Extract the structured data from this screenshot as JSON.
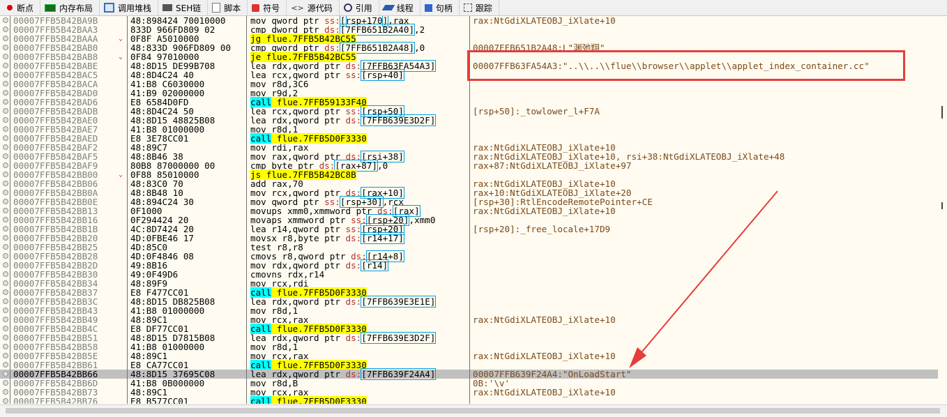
{
  "tabs": [
    {
      "label": "断点",
      "icon": "breakpoint-dot-icon",
      "cls": "ic-dot"
    },
    {
      "label": "内存布局",
      "icon": "memory-map-icon",
      "cls": "ic-mem"
    },
    {
      "label": "调用堆栈",
      "icon": "call-stack-icon",
      "cls": "ic-stack"
    },
    {
      "label": "SEH链",
      "icon": "seh-chain-icon",
      "cls": "ic-seh"
    },
    {
      "label": "脚本",
      "icon": "script-icon",
      "cls": "ic-script"
    },
    {
      "label": "符号",
      "icon": "symbols-icon",
      "cls": "ic-sym"
    },
    {
      "label": "源代码",
      "icon": "source-code-icon",
      "cls": "ic-src",
      "glyph": "<>"
    },
    {
      "label": "引用",
      "icon": "references-icon",
      "cls": "ic-ref"
    },
    {
      "label": "线程",
      "icon": "threads-icon",
      "cls": "ic-thr"
    },
    {
      "label": "句柄",
      "icon": "handles-icon",
      "cls": "ic-hdl"
    },
    {
      "label": "跟踪",
      "icon": "trace-icon",
      "cls": "ic-trc"
    }
  ],
  "highlight_box_color": "#e63c3c",
  "rows": [
    {
      "addr": "00007FFB5B42BA9B",
      "bytes": "48:898424 70010000",
      "ins": [
        [
          "mov qword ptr "
        ],
        [
          "ss:",
          "sreg"
        ],
        [
          "[",
          "mr"
        ],
        [
          "rsp+170",
          ""
        ],
        [
          "]",
          "mr"
        ],
        [
          ",rax"
        ]
      ],
      "cmt": "rax:NtGdiXLATEOBJ_iXlate+10"
    },
    {
      "addr": "00007FFB5B42BAA3",
      "bytes": "833D 966FD809 02",
      "ins": [
        [
          "cmp dword ptr "
        ],
        [
          "ds:",
          "sreg"
        ],
        [
          "[7FFB651B2A40]",
          "mr"
        ],
        [
          ",2"
        ]
      ],
      "cmt": ""
    },
    {
      "addr": "00007FFB5B42BAAA",
      "arrow": "⌄",
      "bytes": "0F8F A5010000",
      "ins": [
        [
          "jg",
          "kw"
        ],
        [
          " flue.7FFB5B42BC55",
          "kw"
        ]
      ],
      "cmt": ""
    },
    {
      "addr": "00007FFB5B42BAB0",
      "bytes": "48:833D 906FD809 00",
      "ins": [
        [
          "cmp qword ptr "
        ],
        [
          "ds:",
          "sreg"
        ],
        [
          "[7FFB651B2A48]",
          "mr"
        ],
        [
          ",0"
        ]
      ],
      "cmt": "00007FFB651B2A48:L\"渊弛翔\""
    },
    {
      "addr": "00007FFB5B42BAB8",
      "arrow": "⌄",
      "bytes": "0F84 97010000",
      "ins": [
        [
          "je",
          "kw"
        ],
        [
          " flue.7FFB5B42BC55",
          "kw"
        ]
      ],
      "cmt": ""
    },
    {
      "addr": "00007FFB5B42BABE",
      "bytes": "48:8D15 DE99B708",
      "ins": [
        [
          "lea rdx,qword ptr "
        ],
        [
          "ds:",
          "sreg"
        ],
        [
          "[7FFB63FA54A3]",
          "mr"
        ]
      ],
      "cmt": "00007FFB63FA54A3:\"..\\\\..\\\\flue\\\\browser\\\\applet\\\\applet_index_container.cc\""
    },
    {
      "addr": "00007FFB5B42BAC5",
      "bytes": "48:8D4C24 40",
      "ins": [
        [
          "lea rcx,qword ptr "
        ],
        [
          "ss:",
          "sreg"
        ],
        [
          "[rsp+40]",
          "mr"
        ]
      ],
      "cmt": ""
    },
    {
      "addr": "00007FFB5B42BACA",
      "bytes": "41:B8 C6030000",
      "ins": [
        [
          "mov r8d,3C6"
        ]
      ],
      "cmt": ""
    },
    {
      "addr": "00007FFB5B42BAD0",
      "bytes": "41:B9 02000000",
      "ins": [
        [
          "mov r9d,2"
        ]
      ],
      "cmt": ""
    },
    {
      "addr": "00007FFB5B42BAD6",
      "bytes": "E8 6584D0FD",
      "ins": [
        [
          "call",
          "call"
        ],
        [
          " flue.7FFB59133F40",
          "kw"
        ]
      ],
      "cmt": ""
    },
    {
      "addr": "00007FFB5B42BADB",
      "bytes": "48:8D4C24 50",
      "ins": [
        [
          "lea rcx,qword ptr "
        ],
        [
          "ss:",
          "sreg"
        ],
        [
          "[rsp+50]",
          "mr"
        ]
      ],
      "cmt": "[rsp+50]:_towlower_l+F7A"
    },
    {
      "addr": "00007FFB5B42BAE0",
      "bytes": "48:8D15 48825B08",
      "ins": [
        [
          "lea rdx,qword ptr "
        ],
        [
          "ds:",
          "sreg"
        ],
        [
          "[7FFB639E3D2F]",
          "mr"
        ]
      ],
      "cmt": ""
    },
    {
      "addr": "00007FFB5B42BAE7",
      "bytes": "41:B8 01000000",
      "ins": [
        [
          "mov r8d,1"
        ]
      ],
      "cmt": ""
    },
    {
      "addr": "00007FFB5B42BAED",
      "bytes": "E8 3E78CC01",
      "ins": [
        [
          "call",
          "call"
        ],
        [
          " flue.7FFB5D0F3330",
          "kw"
        ]
      ],
      "cmt": ""
    },
    {
      "addr": "00007FFB5B42BAF2",
      "bytes": "48:89C7",
      "ins": [
        [
          "mov rdi,rax"
        ]
      ],
      "cmt": "rax:NtGdiXLATEOBJ_iXlate+10"
    },
    {
      "addr": "00007FFB5B42BAF5",
      "bytes": "48:8B46 38",
      "ins": [
        [
          "mov rax,qword ptr "
        ],
        [
          "ds:",
          "sreg"
        ],
        [
          "[rsi+38]",
          "mr"
        ]
      ],
      "cmt": "rax:NtGdiXLATEOBJ_iXlate+10, rsi+38:NtGdiXLATEOBJ_iXlate+48"
    },
    {
      "addr": "00007FFB5B42BAF9",
      "bytes": "80B8 87000000 00",
      "ins": [
        [
          "cmp byte ptr "
        ],
        [
          "ds:",
          "sreg"
        ],
        [
          "[rax+87]",
          "mr"
        ],
        [
          ",0"
        ]
      ],
      "cmt": "rax+87:NtGdiXLATEOBJ_iXlate+97"
    },
    {
      "addr": "00007FFB5B42BB00",
      "arrow": "⌄",
      "bytes": "0F88 85010000",
      "ins": [
        [
          "js",
          "kw"
        ],
        [
          " flue.7FFB5B42BC8B",
          "kw"
        ]
      ],
      "cmt": ""
    },
    {
      "addr": "00007FFB5B42BB06",
      "bytes": "48:83C0 70",
      "ins": [
        [
          "add rax,70"
        ]
      ],
      "cmt": "rax:NtGdiXLATEOBJ_iXlate+10"
    },
    {
      "addr": "00007FFB5B42BB0A",
      "bytes": "48:8B48 10",
      "ins": [
        [
          "mov rcx,qword ptr "
        ],
        [
          "ds:",
          "sreg"
        ],
        [
          "[rax+10]",
          "mr"
        ]
      ],
      "cmt": "rax+10:NtGdiXLATEOBJ_iXlate+20"
    },
    {
      "addr": "00007FFB5B42BB0E",
      "bytes": "48:894C24 30",
      "ins": [
        [
          "mov qword ptr "
        ],
        [
          "ss:",
          "sreg"
        ],
        [
          "[rsp+30]",
          "mr"
        ],
        [
          ",rcx"
        ]
      ],
      "cmt": "[rsp+30]:RtlEncodeRemotePointer+CE"
    },
    {
      "addr": "00007FFB5B42BB13",
      "bytes": "0F1000",
      "ins": [
        [
          "movups xmm0,xmmword ptr "
        ],
        [
          "ds:",
          "sreg"
        ],
        [
          "[rax]",
          "mr"
        ]
      ],
      "cmt": "rax:NtGdiXLATEOBJ_iXlate+10"
    },
    {
      "addr": "00007FFB5B42BB16",
      "bytes": "0F294424 20",
      "ins": [
        [
          "movaps xmmword ptr "
        ],
        [
          "ss:",
          "sreg"
        ],
        [
          "[rsp+20]",
          "mr"
        ],
        [
          ",xmm0"
        ]
      ],
      "cmt": ""
    },
    {
      "addr": "00007FFB5B42BB1B",
      "bytes": "4C:8D7424 20",
      "ins": [
        [
          "lea r14,qword ptr "
        ],
        [
          "ss:",
          "sreg"
        ],
        [
          "[rsp+20]",
          "mr"
        ]
      ],
      "cmt": "[rsp+20]:_free_locale+17D9"
    },
    {
      "addr": "00007FFB5B42BB20",
      "bytes": "4D:0FBE46 17",
      "ins": [
        [
          "movsx r8,byte ptr "
        ],
        [
          "ds:",
          "sreg"
        ],
        [
          "[r14+17]",
          "mr"
        ]
      ],
      "cmt": ""
    },
    {
      "addr": "00007FFB5B42BB25",
      "bytes": "4D:85C0",
      "ins": [
        [
          "test r8,r8"
        ]
      ],
      "cmt": ""
    },
    {
      "addr": "00007FFB5B42BB28",
      "bytes": "4D:0F4846 08",
      "ins": [
        [
          "cmovs r8,qword ptr "
        ],
        [
          "ds:",
          "sreg"
        ],
        [
          "[r14+8]",
          "mr"
        ]
      ],
      "cmt": ""
    },
    {
      "addr": "00007FFB5B42BB2D",
      "bytes": "49:8B16",
      "ins": [
        [
          "mov rdx,qword ptr "
        ],
        [
          "ds:",
          "sreg"
        ],
        [
          "[r14]",
          "mr"
        ]
      ],
      "cmt": ""
    },
    {
      "addr": "00007FFB5B42BB30",
      "bytes": "49:0F49D6",
      "ins": [
        [
          "cmovns rdx,r14"
        ]
      ],
      "cmt": ""
    },
    {
      "addr": "00007FFB5B42BB34",
      "bytes": "48:89F9",
      "ins": [
        [
          "mov rcx,rdi"
        ]
      ],
      "cmt": ""
    },
    {
      "addr": "00007FFB5B42BB37",
      "bytes": "E8 F477CC01",
      "ins": [
        [
          "call",
          "call"
        ],
        [
          " flue.7FFB5D0F3330",
          "kw"
        ]
      ],
      "cmt": ""
    },
    {
      "addr": "00007FFB5B42BB3C",
      "bytes": "48:8D15 DB825B08",
      "ins": [
        [
          "lea rdx,qword ptr "
        ],
        [
          "ds:",
          "sreg"
        ],
        [
          "[7FFB639E3E1E]",
          "mr"
        ]
      ],
      "cmt": ""
    },
    {
      "addr": "00007FFB5B42BB43",
      "bytes": "41:B8 01000000",
      "ins": [
        [
          "mov r8d,1"
        ]
      ],
      "cmt": ""
    },
    {
      "addr": "00007FFB5B42BB49",
      "bytes": "48:89C1",
      "ins": [
        [
          "mov rcx,rax"
        ]
      ],
      "cmt": "rax:NtGdiXLATEOBJ_iXlate+10"
    },
    {
      "addr": "00007FFB5B42BB4C",
      "bytes": "E8 DF77CC01",
      "ins": [
        [
          "call",
          "call"
        ],
        [
          " flue.7FFB5D0F3330",
          "kw"
        ]
      ],
      "cmt": ""
    },
    {
      "addr": "00007FFB5B42BB51",
      "bytes": "48:8D15 D7815B08",
      "ins": [
        [
          "lea rdx,qword ptr "
        ],
        [
          "ds:",
          "sreg"
        ],
        [
          "[7FFB639E3D2F]",
          "mr"
        ]
      ],
      "cmt": ""
    },
    {
      "addr": "00007FFB5B42BB58",
      "bytes": "41:B8 01000000",
      "ins": [
        [
          "mov r8d,1"
        ]
      ],
      "cmt": ""
    },
    {
      "addr": "00007FFB5B42BB5E",
      "bytes": "48:89C1",
      "ins": [
        [
          "mov rcx,rax"
        ]
      ],
      "cmt": "rax:NtGdiXLATEOBJ_iXlate+10"
    },
    {
      "addr": "00007FFB5B42BB61",
      "bytes": "E8 CA77CC01",
      "ins": [
        [
          "call",
          "call"
        ],
        [
          " flue.7FFB5D0F3330",
          "kw"
        ]
      ],
      "cmt": ""
    },
    {
      "addr": "00007FFB5B42BB66",
      "sel": true,
      "bytes": "48:8D15 37695C08",
      "ins": [
        [
          "lea rdx,qword ptr "
        ],
        [
          "ds:",
          "sreg"
        ],
        [
          "[7FFB639F24A4]",
          "mr"
        ]
      ],
      "cmt": "00007FFB639F24A4:\"OnLoadStart\""
    },
    {
      "addr": "00007FFB5B42BB6D",
      "bytes": "41:B8 0B000000",
      "ins": [
        [
          "mov r8d,B"
        ]
      ],
      "cmt": "0B:'\\v'"
    },
    {
      "addr": "00007FFB5B42BB73",
      "bytes": "48:89C1",
      "ins": [
        [
          "mov rcx,rax"
        ]
      ],
      "cmt": "rax:NtGdiXLATEOBJ_iXlate+10"
    },
    {
      "addr": "00007FFB5B42BB76",
      "bytes": "E8 B577CC01",
      "ins": [
        [
          "call",
          "call"
        ],
        [
          " flue.7FFB5D0F3330",
          "kw"
        ]
      ],
      "cmt": ""
    }
  ]
}
